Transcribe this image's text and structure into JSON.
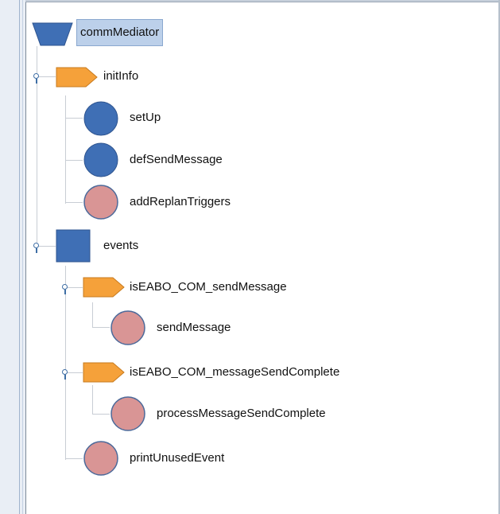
{
  "colors": {
    "task_blue": "#3f6fb5",
    "action_pink": "#d99595",
    "condition_orange": "#f5a13a",
    "selection": "#bcd0ea",
    "connector": "#c8cdd4"
  },
  "tree": {
    "root": {
      "label": "commMediator",
      "icon": "trapezoid-icon"
    },
    "initInfo": {
      "label": "initInfo",
      "icon": "orange-pentagon-icon",
      "children": [
        {
          "label": "setUp",
          "icon": "blue-circle-icon"
        },
        {
          "label": "defSendMessage",
          "icon": "blue-circle-icon"
        },
        {
          "label": "addReplanTriggers",
          "icon": "pink-circle-icon"
        }
      ]
    },
    "events": {
      "label": "events",
      "icon": "blue-square-icon",
      "children": [
        {
          "label": "isEABO_COM_sendMessage",
          "icon": "orange-pentagon-icon",
          "children": [
            {
              "label": "sendMessage",
              "icon": "pink-circle-icon"
            }
          ]
        },
        {
          "label": "isEABO_COM_messageSendComplete",
          "icon": "orange-pentagon-icon",
          "children": [
            {
              "label": "processMessageSendComplete",
              "icon": "pink-circle-icon"
            }
          ]
        },
        {
          "label": "printUnusedEvent",
          "icon": "pink-circle-icon"
        }
      ]
    }
  }
}
